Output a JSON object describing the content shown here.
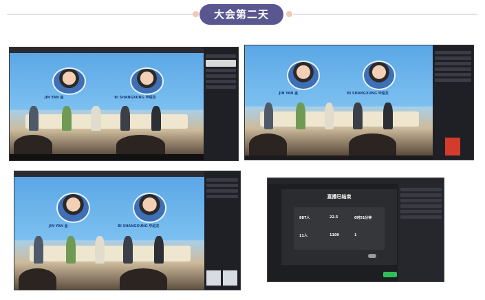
{
  "header": {
    "title": "大会第二天",
    "line_color": "#b9b5d6",
    "pill_color": "#5a5790",
    "dot_color": "#f0c9b9"
  },
  "screens": [
    {
      "id": "top-left"
    },
    {
      "id": "top-right"
    },
    {
      "id": "bottom-left"
    },
    {
      "id": "bottom-right"
    }
  ],
  "stage": {
    "speaker_left": {
      "name": "JIN YAN 金"
    },
    "speaker_right": {
      "name": "BI SHANGXUNG 毕绍龙"
    }
  },
  "live_summary": {
    "title": "直播已结束",
    "stats": [
      {
        "value": "887人"
      },
      {
        "value": "22.5"
      },
      {
        "value": "0时51分钟"
      },
      {
        "value": "11人"
      },
      {
        "value": "1109"
      },
      {
        "value": "1"
      }
    ]
  }
}
